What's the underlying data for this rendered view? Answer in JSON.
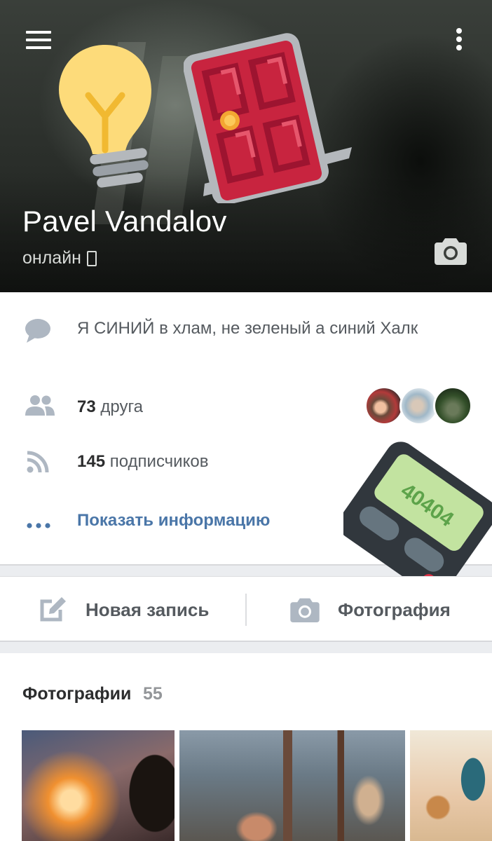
{
  "profile": {
    "name": "Pavel Vandalov",
    "status": "онлайн"
  },
  "info": {
    "status_text": "Я СИНИЙ в хлам, не зеленый а синий Халк",
    "friends_count": "73",
    "friends_label": "друга",
    "followers_count": "145",
    "followers_label": "подписчиков",
    "show_info_label": "Показать информацию"
  },
  "actions": {
    "new_post_label": "Новая запись",
    "photo_label": "Фотография"
  },
  "photos": {
    "title": "Фотографии",
    "count": "55"
  },
  "stickers": {
    "pager_text": "40404"
  },
  "icons": [
    "menu-icon",
    "more-icon",
    "camera-icon",
    "message-icon",
    "friends-icon",
    "rss-icon",
    "dots-icon",
    "edit-icon",
    "lightbulb-sticker",
    "door-sticker",
    "pager-sticker"
  ],
  "colors": {
    "accent": "#4a76a8",
    "text_primary": "#2c2d2e",
    "text_secondary": "#555a5f",
    "icon_gray": "#aeb7c2",
    "count_gray": "#939699"
  }
}
